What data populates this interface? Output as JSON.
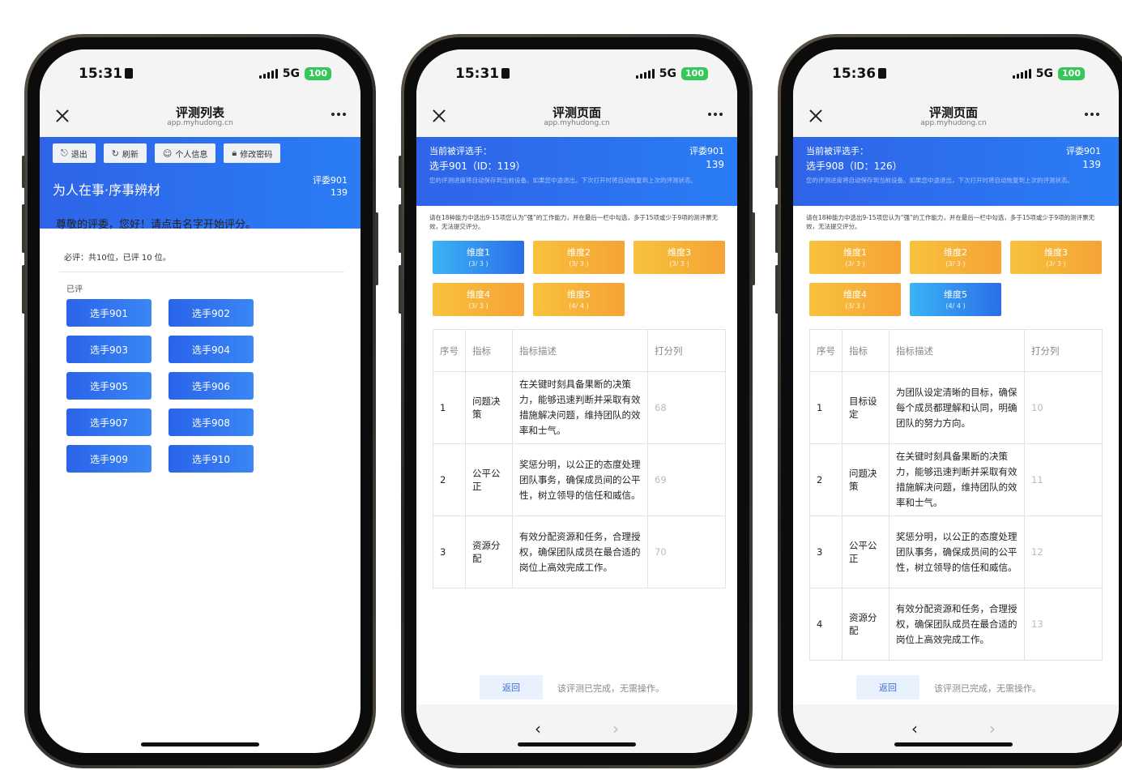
{
  "status_bar": {
    "signal": "5G",
    "battery": "100"
  },
  "phone1": {
    "time": "15:31",
    "nav": {
      "title": "评测列表",
      "url": "app.myhudong.cn"
    },
    "toolbar": {
      "logout": "退出",
      "refresh": "刷新",
      "profile": "个人信息",
      "change_password": "修改密码"
    },
    "header_title": "为人在事·序事辨材",
    "judge": "评委901",
    "judge_id": "139",
    "greeting": "尊敬的评委，您好！请点击名字开始评分。",
    "must_rate": "必评：共10位，已评 10 位。",
    "rated_label": "已评",
    "candidates": [
      "选手901",
      "选手902",
      "选手903",
      "选手904",
      "选手905",
      "选手906",
      "选手907",
      "选手908",
      "选手909",
      "选手910"
    ]
  },
  "phone2": {
    "time": "15:31",
    "nav": {
      "title": "评测页面",
      "url": "app.myhudong.cn"
    },
    "current_label": "当前被评选手：",
    "candidate": "选手901（ID：119）",
    "judge": "评委901",
    "judge_id": "139",
    "note": "您的评测进度将自动保存到当前设备。如果您中途退出，下次打开时将自动恢复到上次的评测状态。",
    "instructions": "请在18种能力中选出9-15项您认为“强”的工作能力，并在最后一栏中勾选，多于15项或少于9项的测评票无效，无法提交评分。",
    "dimensions": [
      {
        "name": "维度1",
        "count": "(3/ 3 )",
        "state": "active"
      },
      {
        "name": "维度2",
        "count": "(3/ 3 )",
        "state": "done"
      },
      {
        "name": "维度3",
        "count": "(3/ 3 )",
        "state": "done"
      },
      {
        "name": "维度4",
        "count": "(3/ 3 )",
        "state": "done"
      },
      {
        "name": "维度5",
        "count": "(4/ 4 )",
        "state": "done"
      }
    ],
    "table_headers": [
      "序号",
      "指标",
      "指标描述",
      "打分列"
    ],
    "rows": [
      {
        "no": "1",
        "indicator": "问题决策",
        "desc": "在关键时刻具备果断的决策力，能够迅速判断并采取有效措施解决问题，维持团队的效率和士气。",
        "score": "68"
      },
      {
        "no": "2",
        "indicator": "公平公正",
        "desc": "奖惩分明，以公正的态度处理团队事务，确保成员间的公平性，树立领导的信任和威信。",
        "score": "69"
      },
      {
        "no": "3",
        "indicator": "资源分配",
        "desc": "有效分配资源和任务，合理授权，确保团队成员在最合适的岗位上高效完成工作。",
        "score": "70"
      }
    ],
    "back": "返回",
    "done_msg": "该评测已完成，无需操作。"
  },
  "phone3": {
    "time": "15:36",
    "nav": {
      "title": "评测页面",
      "url": "app.myhudong.cn"
    },
    "current_label": "当前被评选手：",
    "candidate": "选手908（ID：126）",
    "judge": "评委901",
    "judge_id": "139",
    "note": "您的评测进度将自动保存到当前设备。如果您中途退出，下次打开时将自动恢复到上次的评测状态。",
    "instructions": "请在18种能力中选出9-15项您认为“强”的工作能力，并在最后一栏中勾选，多于15项或少于9项的测评票无效，无法提交评分。",
    "dimensions": [
      {
        "name": "维度1",
        "count": "(3/ 3 )",
        "state": "done"
      },
      {
        "name": "维度2",
        "count": "(3/ 3 )",
        "state": "done"
      },
      {
        "name": "维度3",
        "count": "(3/ 3 )",
        "state": "done"
      },
      {
        "name": "维度4",
        "count": "(3/ 3 )",
        "state": "done"
      },
      {
        "name": "维度5",
        "count": "(4/ 4 )",
        "state": "active"
      }
    ],
    "table_headers": [
      "序号",
      "指标",
      "指标描述",
      "打分列"
    ],
    "rows": [
      {
        "no": "1",
        "indicator": "目标设定",
        "desc": "为团队设定清晰的目标，确保每个成员都理解和认同，明确团队的努力方向。",
        "score": "10"
      },
      {
        "no": "2",
        "indicator": "问题决策",
        "desc": "在关键时刻具备果断的决策力，能够迅速判断并采取有效措施解决问题，维持团队的效率和士气。",
        "score": "11"
      },
      {
        "no": "3",
        "indicator": "公平公正",
        "desc": "奖惩分明，以公正的态度处理团队事务，确保成员间的公平性，树立领导的信任和威信。",
        "score": "12"
      },
      {
        "no": "4",
        "indicator": "资源分配",
        "desc": "有效分配资源和任务，合理授权，确保团队成员在最合适的岗位上高效完成工作。",
        "score": "13"
      }
    ],
    "back": "返回",
    "done_msg": "该评测已完成，无需操作。"
  }
}
